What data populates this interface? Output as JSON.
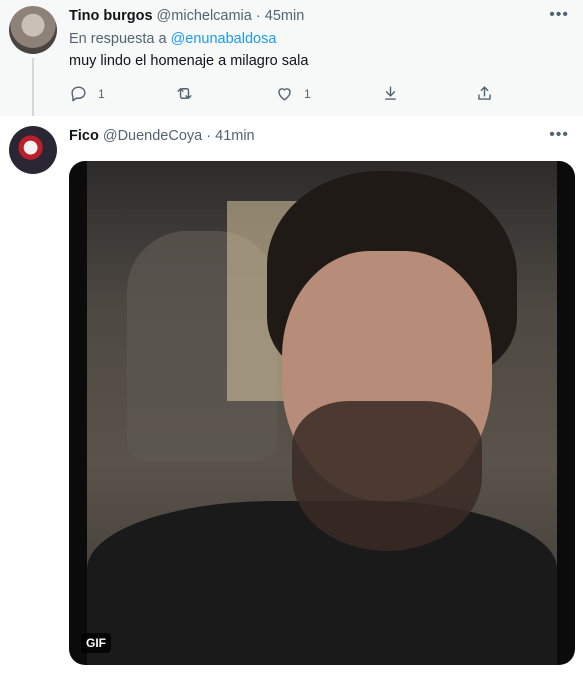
{
  "tweets": [
    {
      "display_name": "Tino burgos",
      "handle": "@michelcamia",
      "separator": "·",
      "time": "45min",
      "reply_prefix": "En respuesta a",
      "reply_mention": "@enunabaldosa",
      "text": "muy lindo el homenaje a milagro sala",
      "reply_count": "1",
      "retweet_count": "",
      "like_count": "1"
    },
    {
      "display_name": "Fico",
      "handle": "@DuendeCoya",
      "separator": "·",
      "time": "41min",
      "media_badge": "GIF"
    }
  ],
  "icons": [
    "more-icon",
    "reply-icon",
    "retweet-icon",
    "like-icon",
    "bookmark-icon",
    "share-icon"
  ],
  "colors": {
    "link": "#1d9bf0",
    "muted": "#536471",
    "highlight_bg": "#f7f9f9"
  }
}
